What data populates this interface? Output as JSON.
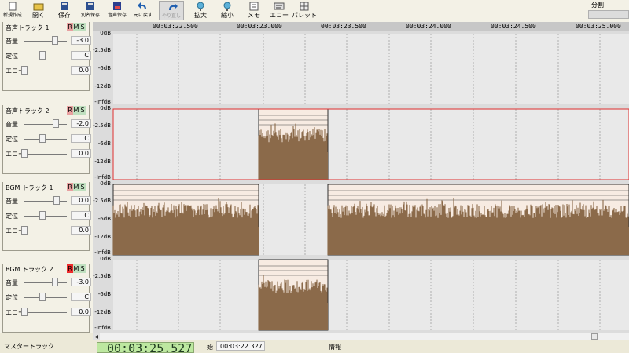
{
  "toolbar": [
    {
      "id": "new",
      "label": "新規作成",
      "icon": "new-file-icon",
      "small": true
    },
    {
      "id": "open",
      "label": "開く",
      "icon": "open-folder-icon"
    },
    {
      "id": "save",
      "label": "保存",
      "icon": "save-icon"
    },
    {
      "id": "saveas",
      "label": "別名保存",
      "icon": "save-as-icon",
      "small": true
    },
    {
      "id": "audiosave",
      "label": "音声保存",
      "icon": "audio-save-icon",
      "small": true
    },
    {
      "id": "undo",
      "label": "元に戻す",
      "icon": "undo-icon",
      "small": true
    },
    {
      "id": "redo",
      "label": "やり直し",
      "icon": "redo-icon",
      "small": true,
      "disabled": true,
      "pressed": true
    },
    {
      "id": "zoomin",
      "label": "拡大",
      "icon": "zoom-in-icon"
    },
    {
      "id": "zoomout",
      "label": "縮小",
      "icon": "zoom-out-icon"
    },
    {
      "id": "memo",
      "label": "メモ",
      "icon": "memo-icon"
    },
    {
      "id": "echo",
      "label": "エコー",
      "icon": "echo-icon"
    },
    {
      "id": "palette",
      "label": "パレット",
      "icon": "palette-icon"
    }
  ],
  "split": {
    "label": "分割"
  },
  "ruler": {
    "ticks": [
      "00:03:22.500",
      "00:03:23.000",
      "00:03:23.500",
      "00:03:24.000",
      "00:03:24.500",
      "00:03:25.000"
    ]
  },
  "labels": {
    "volume": "音量",
    "pan": "定位",
    "echo": "エコー",
    "r": "R",
    "m": "M",
    "s": "S"
  },
  "tracks": [
    {
      "name": "音声トラック 1",
      "volume": "-3.0",
      "pan": "C",
      "echo": "0.0",
      "rec_on": false,
      "vol_knob": 0.85,
      "pan_knob": 0.5,
      "echo_knob": 0.0,
      "clips": []
    },
    {
      "name": "音声トラック 2",
      "volume": "-2.0",
      "pan": "C",
      "echo": "0.0",
      "rec_on": false,
      "vol_knob": 0.88,
      "pan_knob": 0.5,
      "echo_knob": 0.0,
      "selected": true,
      "clips": [
        {
          "start": 1,
          "end": 2
        }
      ]
    },
    {
      "name": "BGM トラック 1",
      "volume": "0.0",
      "pan": "C",
      "echo": "0.0",
      "rec_on": false,
      "vol_knob": 0.9,
      "pan_knob": 0.5,
      "echo_knob": 0.0,
      "clips": [
        {
          "start": 0,
          "end": 0
        },
        {
          "start": 2,
          "end": 4
        }
      ]
    },
    {
      "name": "BGM トラック 2",
      "volume": "-3.0",
      "pan": "C",
      "echo": "0.0",
      "rec_on": true,
      "vol_knob": 0.85,
      "pan_knob": 0.5,
      "echo_knob": 0.0,
      "clips": [
        {
          "start": 1,
          "end": 2
        }
      ]
    }
  ],
  "db_labels": [
    "0dB",
    "-2.5dB",
    "-6dB",
    "-12dB",
    "-InfdB"
  ],
  "colors": {
    "wave": "#8b6a4a",
    "selection": "#e03030",
    "clip_bg": "#f7ebe2"
  },
  "status": {
    "master": "マスタートラック",
    "time": "00:03:25.527",
    "from_label": "始",
    "from_time": "00:03:22.327",
    "info": "情報"
  }
}
